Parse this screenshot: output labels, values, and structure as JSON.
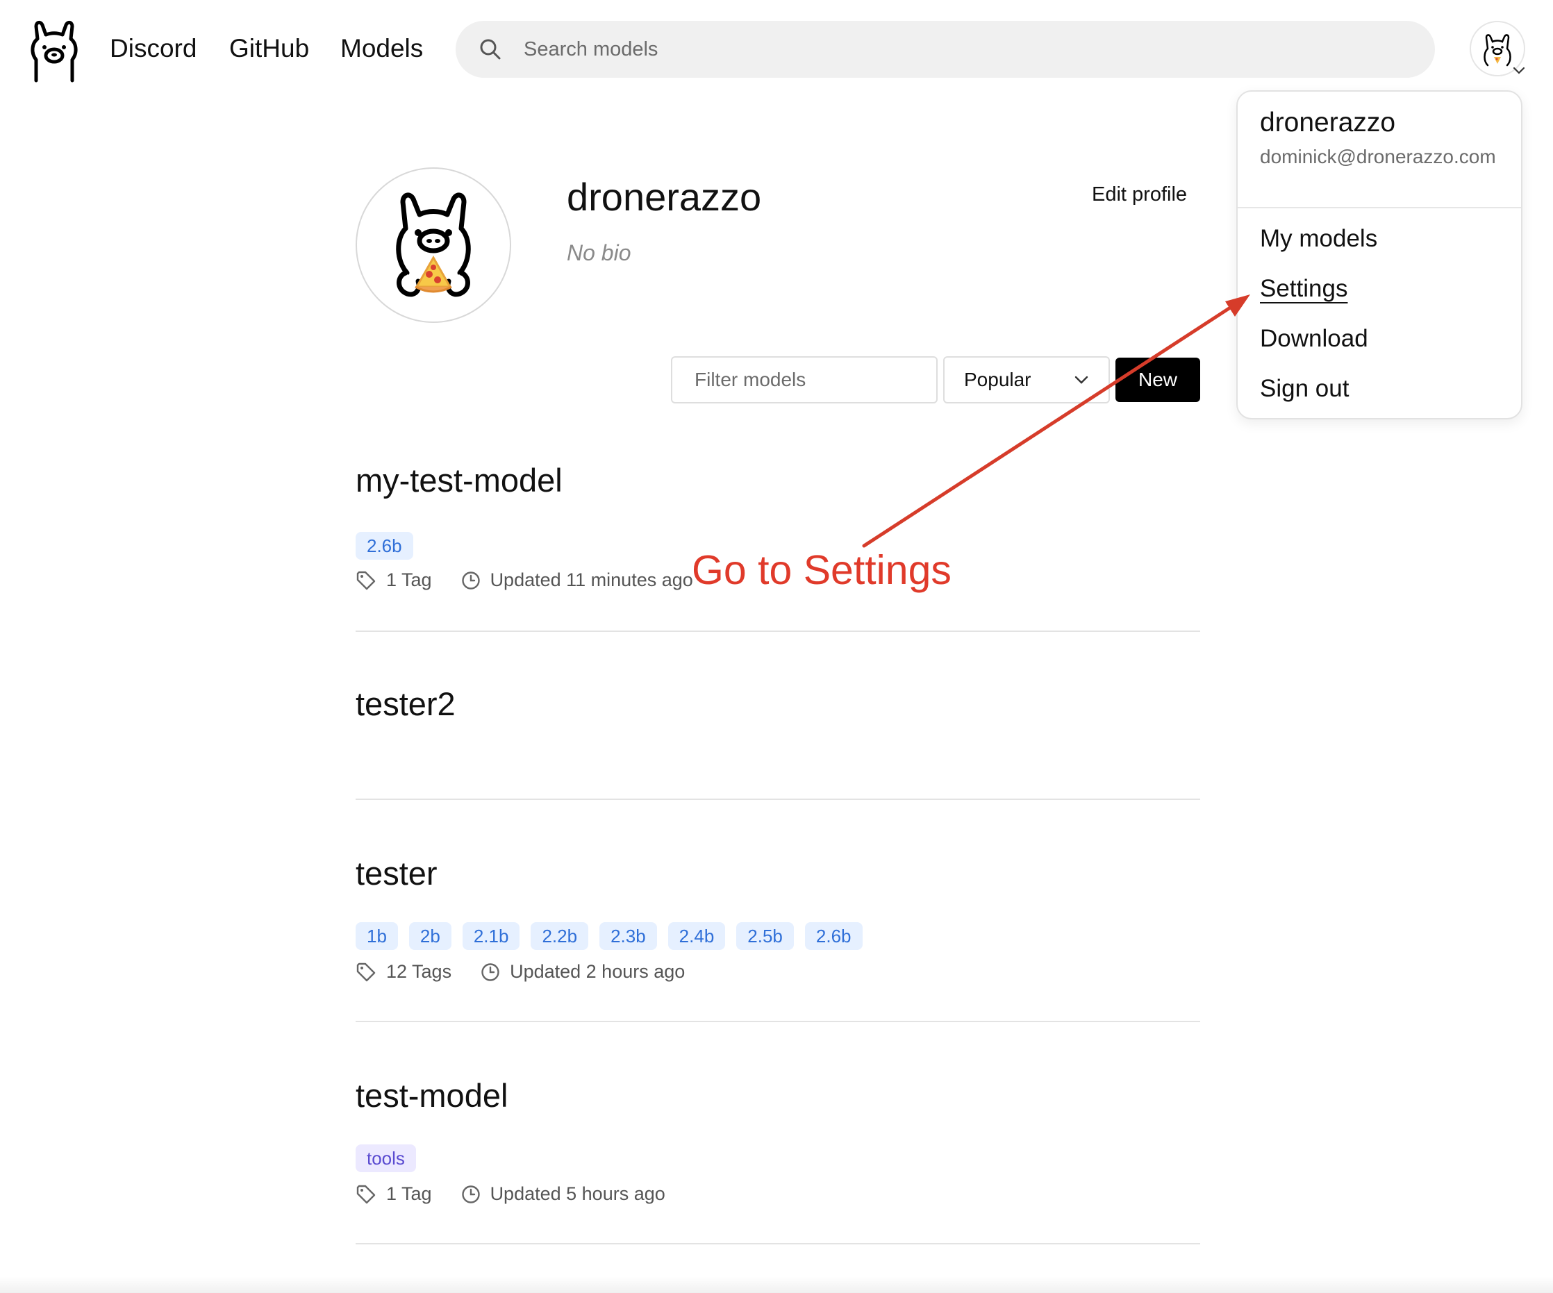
{
  "header": {
    "nav": [
      "Discord",
      "GitHub",
      "Models"
    ],
    "search_placeholder": "Search models",
    "logo_icon": "llama-logo-icon",
    "avatar_icon": "user-avatar-icon"
  },
  "profile": {
    "username": "dronerazzo",
    "bio": "No bio",
    "edit_label": "Edit profile"
  },
  "controls": {
    "filter_placeholder": "Filter models",
    "sort_value": "Popular",
    "new_label": "New"
  },
  "models": [
    {
      "name": "my-test-model",
      "tags": [
        "2.6b"
      ],
      "tag_count": "1 Tag",
      "updated": "Updated 11 minutes ago"
    },
    {
      "name": "tester2",
      "tags": [],
      "tag_count": "",
      "updated": ""
    },
    {
      "name": "tester",
      "tags": [
        "1b",
        "2b",
        "2.1b",
        "2.2b",
        "2.3b",
        "2.4b",
        "2.5b",
        "2.6b"
      ],
      "tag_count": "12 Tags",
      "updated": "Updated 2 hours ago"
    },
    {
      "name": "test-model",
      "tags": [
        "tools"
      ],
      "tag_count": "1 Tag",
      "updated": "Updated 5 hours ago"
    }
  ],
  "menu": {
    "username": "dronerazzo",
    "email": "dominick@dronerazzo.com",
    "items": [
      "My models",
      "Settings",
      "Download",
      "Sign out"
    ]
  },
  "annotation": {
    "text": "Go to Settings",
    "color": "#e03a2a"
  },
  "colors": {
    "tag_bg": "#e6f0ff",
    "tag_text": "#2f6fd8",
    "tools_tag_bg": "#ece9ff",
    "tools_tag_text": "#5a4bd1",
    "primary_button": "#000000"
  }
}
